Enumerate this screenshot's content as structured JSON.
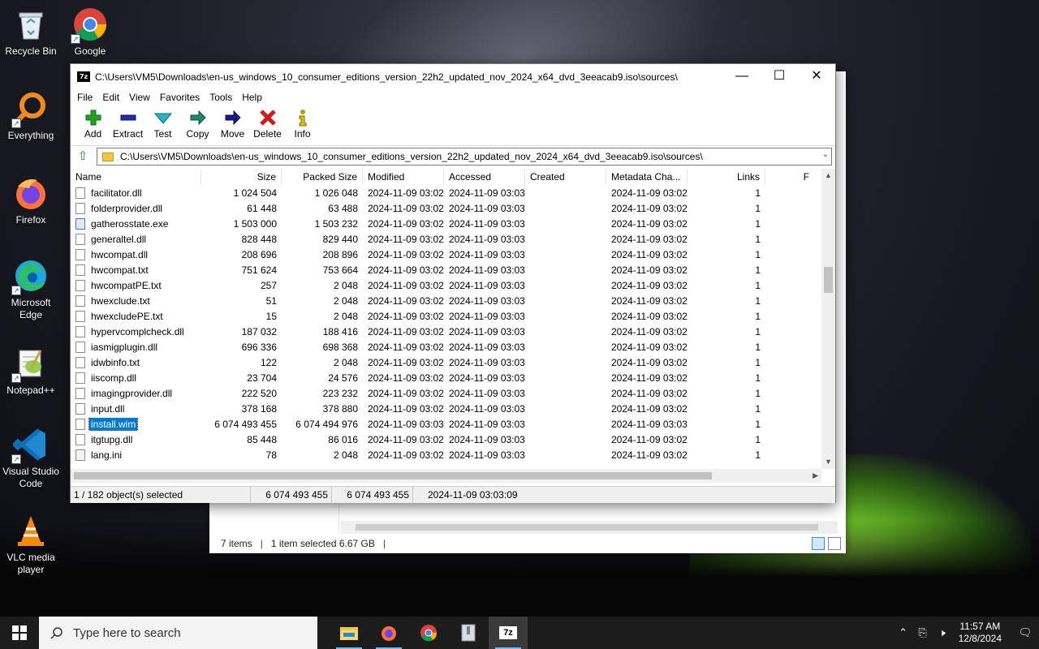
{
  "desktop": {
    "icons": [
      {
        "label": "Recycle Bin"
      },
      {
        "label": "Google Chrome"
      },
      {
        "label": "Everything"
      },
      {
        "label": "Firefox"
      },
      {
        "label": "Microsoft Edge"
      },
      {
        "label": "Notepad++"
      },
      {
        "label": "Visual Studio Code"
      },
      {
        "label": "VLC media player"
      }
    ]
  },
  "explorer": {
    "items_count": "7 items",
    "selected": "1 item selected  6.67 GB"
  },
  "window": {
    "title": "C:\\Users\\VM5\\Downloads\\en-us_windows_10_consumer_editions_version_22h2_updated_nov_2024_x64_dvd_3eeacab9.iso\\sources\\",
    "app_icon": "7z",
    "minimize": "—",
    "maximize": "☐",
    "close": "✕"
  },
  "menu": [
    "File",
    "Edit",
    "View",
    "Favorites",
    "Tools",
    "Help"
  ],
  "toolbar": [
    {
      "label": "Add",
      "icon": "plus-icon",
      "color": "#1fa31f"
    },
    {
      "label": "Extract",
      "icon": "minus-icon",
      "color": "#1f2fa3"
    },
    {
      "label": "Test",
      "icon": "check-icon",
      "color": "#27b3c8"
    },
    {
      "label": "Copy",
      "icon": "arrow-right-icon",
      "color": "#1a8a6a"
    },
    {
      "label": "Move",
      "icon": "arrow-right-icon",
      "color": "#1a1a8a"
    },
    {
      "label": "Delete",
      "icon": "x-icon",
      "color": "#d11a1a"
    },
    {
      "label": "Info",
      "icon": "info-icon",
      "color": "#b8a000"
    }
  ],
  "address": {
    "path": "C:\\Users\\VM5\\Downloads\\en-us_windows_10_consumer_editions_version_22h2_updated_nov_2024_x64_dvd_3eeacab9.iso\\sources\\"
  },
  "columns": [
    "Name",
    "Size",
    "Packed Size",
    "Modified",
    "Accessed",
    "Created",
    "Metadata Cha...",
    "Links",
    "F"
  ],
  "files": [
    {
      "name": "facilitator.dll",
      "size": "1 024 504",
      "packed": "1 026 048",
      "modified": "2024-11-09 03:02",
      "accessed": "2024-11-09 03:03",
      "created": "",
      "meta": "2024-11-09 03:02",
      "links": "1",
      "type": "dll"
    },
    {
      "name": "folderprovider.dll",
      "size": "61 448",
      "packed": "63 488",
      "modified": "2024-11-09 03:02",
      "accessed": "2024-11-09 03:03",
      "created": "",
      "meta": "2024-11-09 03:02",
      "links": "1",
      "type": "dll"
    },
    {
      "name": "gatherosstate.exe",
      "size": "1 503 000",
      "packed": "1 503 232",
      "modified": "2024-11-09 03:02",
      "accessed": "2024-11-09 03:03",
      "created": "",
      "meta": "2024-11-09 03:02",
      "links": "1",
      "type": "exe"
    },
    {
      "name": "generaltel.dll",
      "size": "828 448",
      "packed": "829 440",
      "modified": "2024-11-09 03:02",
      "accessed": "2024-11-09 03:03",
      "created": "",
      "meta": "2024-11-09 03:02",
      "links": "1",
      "type": "dll"
    },
    {
      "name": "hwcompat.dll",
      "size": "208 696",
      "packed": "208 896",
      "modified": "2024-11-09 03:02",
      "accessed": "2024-11-09 03:03",
      "created": "",
      "meta": "2024-11-09 03:02",
      "links": "1",
      "type": "dll"
    },
    {
      "name": "hwcompat.txt",
      "size": "751 624",
      "packed": "753 664",
      "modified": "2024-11-09 03:02",
      "accessed": "2024-11-09 03:03",
      "created": "",
      "meta": "2024-11-09 03:02",
      "links": "1",
      "type": "txt"
    },
    {
      "name": "hwcompatPE.txt",
      "size": "257",
      "packed": "2 048",
      "modified": "2024-11-09 03:02",
      "accessed": "2024-11-09 03:03",
      "created": "",
      "meta": "2024-11-09 03:02",
      "links": "1",
      "type": "txt"
    },
    {
      "name": "hwexclude.txt",
      "size": "51",
      "packed": "2 048",
      "modified": "2024-11-09 03:02",
      "accessed": "2024-11-09 03:03",
      "created": "",
      "meta": "2024-11-09 03:02",
      "links": "1",
      "type": "txt"
    },
    {
      "name": "hwexcludePE.txt",
      "size": "15",
      "packed": "2 048",
      "modified": "2024-11-09 03:02",
      "accessed": "2024-11-09 03:03",
      "created": "",
      "meta": "2024-11-09 03:02",
      "links": "1",
      "type": "txt"
    },
    {
      "name": "hypervcomplcheck.dll",
      "size": "187 032",
      "packed": "188 416",
      "modified": "2024-11-09 03:02",
      "accessed": "2024-11-09 03:03",
      "created": "",
      "meta": "2024-11-09 03:02",
      "links": "1",
      "type": "dll"
    },
    {
      "name": "iasmigplugin.dll",
      "size": "696 336",
      "packed": "698 368",
      "modified": "2024-11-09 03:02",
      "accessed": "2024-11-09 03:03",
      "created": "",
      "meta": "2024-11-09 03:02",
      "links": "1",
      "type": "dll"
    },
    {
      "name": "idwbinfo.txt",
      "size": "122",
      "packed": "2 048",
      "modified": "2024-11-09 03:02",
      "accessed": "2024-11-09 03:03",
      "created": "",
      "meta": "2024-11-09 03:02",
      "links": "1",
      "type": "txt"
    },
    {
      "name": "iiscomp.dll",
      "size": "23 704",
      "packed": "24 576",
      "modified": "2024-11-09 03:02",
      "accessed": "2024-11-09 03:03",
      "created": "",
      "meta": "2024-11-09 03:02",
      "links": "1",
      "type": "dll"
    },
    {
      "name": "imagingprovider.dll",
      "size": "222 520",
      "packed": "223 232",
      "modified": "2024-11-09 03:02",
      "accessed": "2024-11-09 03:03",
      "created": "",
      "meta": "2024-11-09 03:02",
      "links": "1",
      "type": "dll"
    },
    {
      "name": "input.dll",
      "size": "378 168",
      "packed": "378 880",
      "modified": "2024-11-09 03:02",
      "accessed": "2024-11-09 03:03",
      "created": "",
      "meta": "2024-11-09 03:02",
      "links": "1",
      "type": "dll"
    },
    {
      "name": "install.wim",
      "size": "6 074 493 455",
      "packed": "6 074 494 976",
      "modified": "2024-11-09 03:03",
      "accessed": "2024-11-09 03:03",
      "created": "",
      "meta": "2024-11-09 03:03",
      "links": "1",
      "type": "wim",
      "selected": true
    },
    {
      "name": "itgtupg.dll",
      "size": "85 448",
      "packed": "86 016",
      "modified": "2024-11-09 03:02",
      "accessed": "2024-11-09 03:03",
      "created": "",
      "meta": "2024-11-09 03:02",
      "links": "1",
      "type": "dll"
    },
    {
      "name": "lang.ini",
      "size": "78",
      "packed": "2 048",
      "modified": "2024-11-09 03:02",
      "accessed": "2024-11-09 03:03",
      "created": "",
      "meta": "2024-11-09 03:02",
      "links": "1",
      "type": "ini"
    }
  ],
  "status": {
    "selection": "1 / 182 object(s) selected",
    "size": "6 074 493 455",
    "packed": "6 074 493 455",
    "modified": "2024-11-09 03:03:09"
  },
  "taskbar": {
    "search_placeholder": "Type here to search",
    "apps": [
      "file-explorer-icon",
      "firefox-icon",
      "chrome-icon",
      "archive-icon",
      "7zip-icon"
    ],
    "time": "11:57 AM",
    "date": "12/8/2024"
  },
  "colors": {
    "selection": "#0078d7",
    "taskbar": "#1c1c1c",
    "accent_underline": "#76b9ed"
  }
}
